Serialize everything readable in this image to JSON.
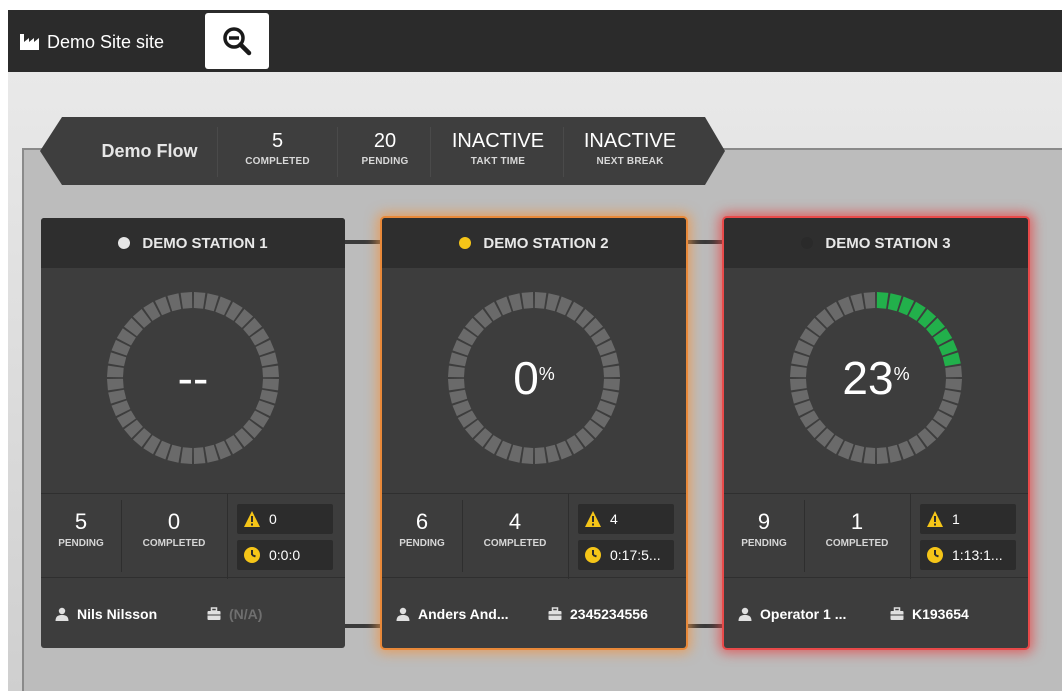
{
  "header": {
    "site_title": "Demo Site site",
    "zoom_button_icon": "zoom-out-icon"
  },
  "flow": {
    "name": "Demo Flow",
    "stats": [
      {
        "value": "5",
        "label": "COMPLETED"
      },
      {
        "value": "20",
        "label": "PENDING"
      },
      {
        "value": "INACTIVE",
        "label": "TAKT TIME"
      },
      {
        "value": "INACTIVE",
        "label": "NEXT BREAK"
      }
    ]
  },
  "stations": [
    {
      "name": "DEMO STATION 1",
      "status_color": "#e6e6e6",
      "gauge_value": "--",
      "gauge_unit": "",
      "progress": 0,
      "pending": "5",
      "pending_label": "PENDING",
      "completed": "0",
      "completed_label": "COMPLETED",
      "warnings": "0",
      "time": "0:0:0",
      "operator": "Nils Nilsson",
      "order": "(N/A)"
    },
    {
      "name": "DEMO STATION 2",
      "status_color": "#f5c518",
      "gauge_value": "0",
      "gauge_unit": "%",
      "progress": 0,
      "pending": "6",
      "pending_label": "PENDING",
      "completed": "4",
      "completed_label": "COMPLETED",
      "warnings": "4",
      "time": "0:17:5...",
      "operator": "Anders And...",
      "order": "2345234556"
    },
    {
      "name": "DEMO STATION 3",
      "status_color": "#2a2a2a",
      "gauge_value": "23",
      "gauge_unit": "%",
      "progress": 0.23,
      "pending": "9",
      "pending_label": "PENDING",
      "completed": "1",
      "completed_label": "COMPLETED",
      "warnings": "1",
      "time": "1:13:1...",
      "operator": "Operator 1 ...",
      "order": "K193654"
    }
  ],
  "colors": {
    "progress_fill": "#22b04b",
    "progress_track": "#6a6a6a",
    "warn_glow": "#e8893a",
    "alert_glow": "#e84a4a",
    "warning_icon": "#f5c518"
  }
}
